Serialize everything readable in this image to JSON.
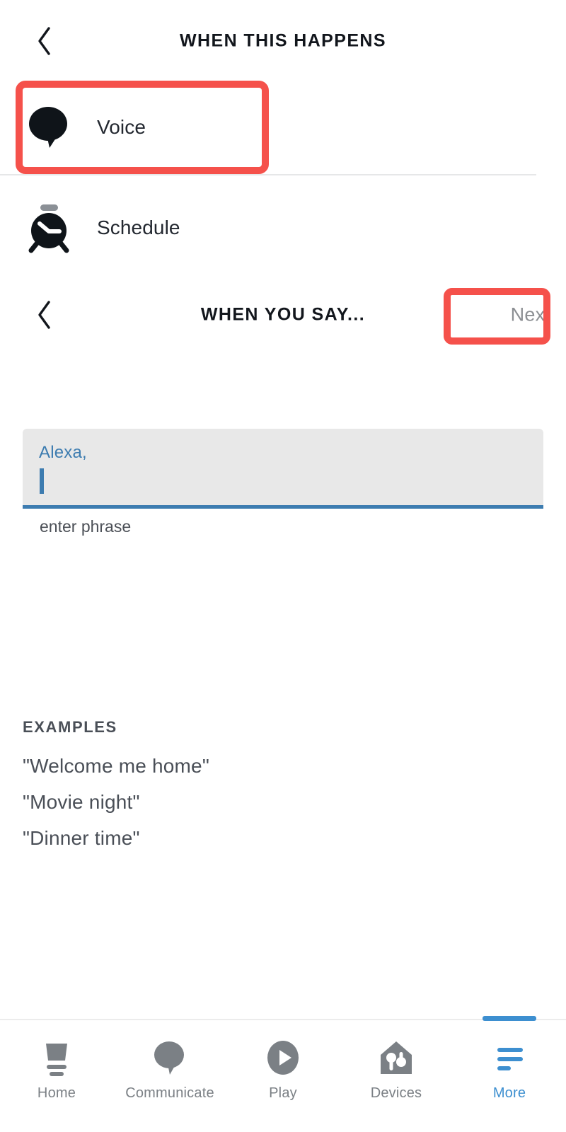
{
  "header_one": {
    "title": "WHEN THIS HAPPENS",
    "back_icon": "chevron-left-icon"
  },
  "triggers": [
    {
      "label": "Voice",
      "icon": "speech-bubble-icon",
      "highlighted": true
    },
    {
      "label": "Schedule",
      "icon": "alarm-clock-icon",
      "highlighted": false
    }
  ],
  "header_two": {
    "title": "WHEN YOU SAY...",
    "back_icon": "chevron-left-icon",
    "next_label": "Next"
  },
  "phrase_input": {
    "prefix": "Alexa,",
    "value": "",
    "placeholder": "enter phrase",
    "helper": "enter phrase"
  },
  "examples": {
    "title": "EXAMPLES",
    "items": [
      "\"Welcome me home\"",
      "\"Movie night\"",
      "\"Dinner time\""
    ]
  },
  "tabbar": {
    "items": [
      {
        "label": "Home",
        "icon": "echo-device-icon",
        "active": false
      },
      {
        "label": "Communicate",
        "icon": "speech-bubble-icon",
        "active": false
      },
      {
        "label": "Play",
        "icon": "play-circle-icon",
        "active": false
      },
      {
        "label": "Devices",
        "icon": "home-bulbs-icon",
        "active": false
      },
      {
        "label": "More",
        "icon": "hamburger-menu-icon",
        "active": true
      }
    ]
  },
  "colors": {
    "highlight": "#f5514b",
    "accent_blue": "#3d8fd0",
    "input_blue": "#3d7cb0",
    "field_bg": "#e8e8e8",
    "icon_gray": "#7b8085",
    "text_dark": "#12161c"
  }
}
